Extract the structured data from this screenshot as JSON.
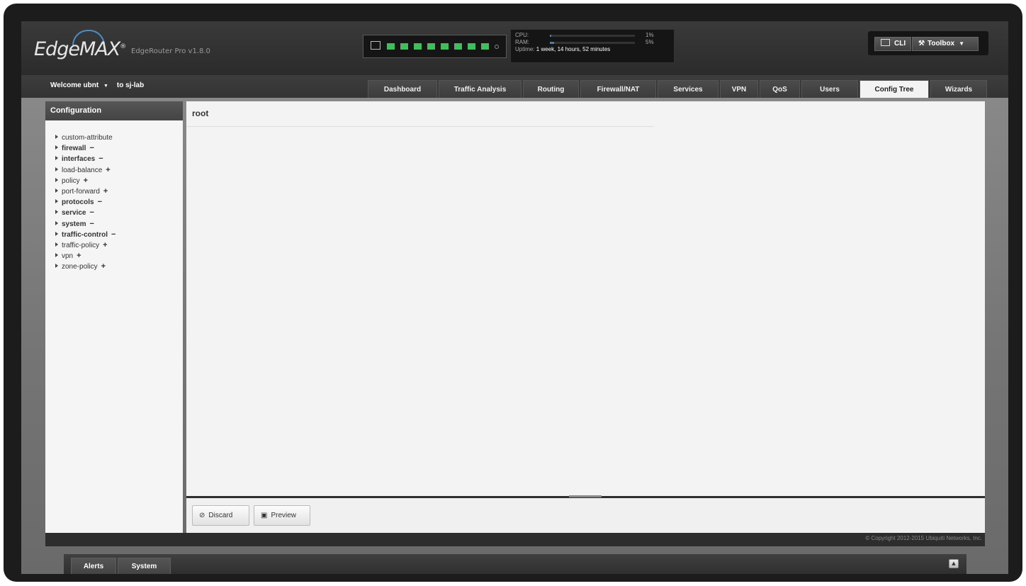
{
  "header": {
    "logo_text": "EdgeMAX",
    "logo_mark": "®",
    "product": "EdgeRouter Pro v1.8.0"
  },
  "ports": {
    "console_icon": "console-port-icon",
    "states": [
      "on",
      "on",
      "on",
      "on",
      "on",
      "on",
      "on",
      "on"
    ],
    "sfp_icon": "sfp-port-icon"
  },
  "system": {
    "cpu_label": "CPU:",
    "cpu_value": "1%",
    "cpu_fraction": 0.01,
    "ram_label": "RAM:",
    "ram_value": "5%",
    "ram_fraction": 0.05,
    "uptime_label": "Uptime:",
    "uptime_value": "1 week, 14 hours, 52 minutes"
  },
  "toolbar": {
    "cli_label": "CLI",
    "toolbox_label": "Toolbox"
  },
  "nav": {
    "welcome": "Welcome ubnt",
    "location": "to sj-lab",
    "tabs": [
      {
        "label": "Dashboard"
      },
      {
        "label": "Traffic Analysis"
      },
      {
        "label": "Routing"
      },
      {
        "label": "Firewall/NAT"
      },
      {
        "label": "Services"
      },
      {
        "label": "VPN"
      },
      {
        "label": "QoS"
      },
      {
        "label": "Users"
      },
      {
        "label": "Config Tree"
      },
      {
        "label": "Wizards"
      }
    ],
    "active_tab": "Config Tree"
  },
  "sidebar": {
    "title": "Configuration",
    "items": [
      {
        "label": "custom-attribute",
        "mark": "",
        "bold": false
      },
      {
        "label": "firewall",
        "mark": "−",
        "bold": true
      },
      {
        "label": "interfaces",
        "mark": "−",
        "bold": true
      },
      {
        "label": "load-balance",
        "mark": "+",
        "bold": false
      },
      {
        "label": "policy",
        "mark": "+",
        "bold": false
      },
      {
        "label": "port-forward",
        "mark": "+",
        "bold": false
      },
      {
        "label": "protocols",
        "mark": "−",
        "bold": true
      },
      {
        "label": "service",
        "mark": "−",
        "bold": true
      },
      {
        "label": "system",
        "mark": "−",
        "bold": true
      },
      {
        "label": "traffic-control",
        "mark": "−",
        "bold": true
      },
      {
        "label": "traffic-policy",
        "mark": "+",
        "bold": false
      },
      {
        "label": "vpn",
        "mark": "+",
        "bold": false
      },
      {
        "label": "zone-policy",
        "mark": "+",
        "bold": false
      }
    ]
  },
  "main": {
    "heading": "root"
  },
  "actions": {
    "discard_label": "Discard",
    "preview_label": "Preview"
  },
  "footer": {
    "copyright": "© Copyright 2012-2015 Ubiquiti Networks, Inc."
  },
  "bottom_tabs": {
    "alerts": "Alerts",
    "system": "System"
  }
}
